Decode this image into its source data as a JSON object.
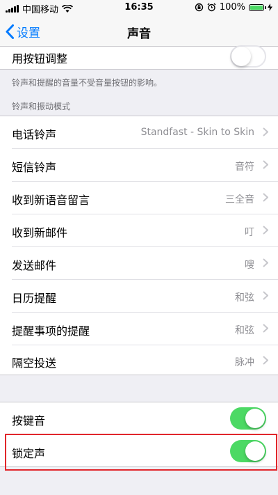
{
  "status_bar": {
    "carrier": "中国移动",
    "time": "16:35",
    "battery": "100%"
  },
  "nav": {
    "back_label": "设置",
    "title": "声音"
  },
  "volume_section": {
    "row_label": "用按钮调整",
    "toggle_on": false,
    "footer": "铃声和提醒的音量不受音量按钮的影响。"
  },
  "patterns_section": {
    "header": "铃声和振动模式",
    "items": [
      {
        "label": "电话铃声",
        "value": "Standfast - Skin to Skin"
      },
      {
        "label": "短信铃声",
        "value": "音符"
      },
      {
        "label": "收到新语音留言",
        "value": "三全音"
      },
      {
        "label": "收到新邮件",
        "value": "叮"
      },
      {
        "label": "发送邮件",
        "value": "嗖"
      },
      {
        "label": "日历提醒",
        "value": "和弦"
      },
      {
        "label": "提醒事项的提醒",
        "value": "和弦"
      },
      {
        "label": "隔空投送",
        "value": "脉冲"
      }
    ]
  },
  "system_sounds": {
    "items": [
      {
        "label": "按键音",
        "toggle_on": true
      },
      {
        "label": "锁定声",
        "toggle_on": true
      }
    ]
  },
  "colors": {
    "accent": "#007aff",
    "toggle_on": "#4cd964",
    "highlight": "#e1262b"
  }
}
